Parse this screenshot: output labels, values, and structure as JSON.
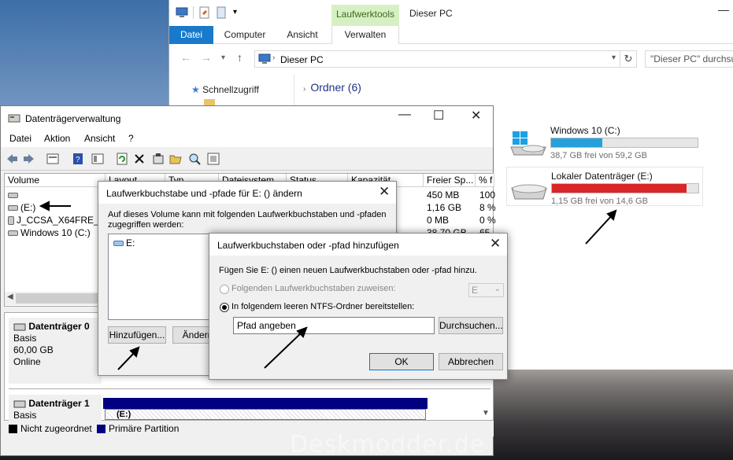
{
  "explorer": {
    "context_tab": "Laufwerktools",
    "title": "Dieser PC",
    "ribbon_tabs": [
      "Datei",
      "Computer",
      "Ansicht",
      "Verwalten"
    ],
    "address": "Dieser PC",
    "search_placeholder": "\"Dieser PC\" durchsuchen",
    "nav_item": "Schnellzugriff",
    "folders_header": "Ordner (6)",
    "drives": [
      {
        "name": "Windows 10 (C:)",
        "free_text": "38,7 GB frei von 59,2 GB",
        "used_fraction": 0.35,
        "bar_color": "#26a0da"
      },
      {
        "name": "Lokaler Datenträger (E:)",
        "free_text": "1,15 GB frei von 14,6 GB",
        "used_fraction": 0.92,
        "bar_color": "#da2626"
      }
    ]
  },
  "diskmgmt": {
    "title": "Datenträgerverwaltung",
    "menu": [
      "Datei",
      "Aktion",
      "Ansicht",
      "?"
    ],
    "columns": [
      "Volume",
      "Layout",
      "Typ",
      "Dateisystem",
      "Status",
      "Kapazität",
      "Freier Sp...",
      "% f"
    ],
    "volumes": [
      "",
      "(E:)",
      "J_CCSA_X64FRE_D...",
      "Windows 10 (C:)"
    ],
    "free_space": [
      "450 MB",
      "1,16 GB",
      "0 MB",
      "38,70 GB"
    ],
    "free_pct": [
      "100",
      "8 %",
      "0 %",
      "65"
    ],
    "disks": [
      {
        "name": "Datenträger 0",
        "type": "Basis",
        "size": "60,00 GB",
        "state": "Online"
      },
      {
        "name": "Datenträger 1",
        "type": "Basis",
        "partition": "(E:)"
      }
    ],
    "legend": {
      "unallocated": "Nicht zugeordnet",
      "primary": "Primäre Partition"
    }
  },
  "dialog_change": {
    "title": "Laufwerkbuchstabe und -pfade für E: () ändern",
    "text": "Auf dieses Volume kann mit folgenden Laufwerkbuchstaben und -pfaden zugegriffen werden:",
    "list_item": "E:",
    "add_button": "Hinzufügen...",
    "change_button": "Ändern..."
  },
  "dialog_add": {
    "title": "Laufwerkbuchstaben oder -pfad hinzufügen",
    "intro": "Fügen Sie E: () einen neuen Laufwerkbuchstaben oder -pfad hinzu.",
    "option_letter": "Folgenden Laufwerkbuchstaben zuweisen:",
    "letter_value": "E",
    "option_folder": "In folgendem leeren NTFS-Ordner bereitstellen:",
    "path_value": "Pfad angeben",
    "browse_button": "Durchsuchen...",
    "ok_button": "OK",
    "cancel_button": "Abbrechen"
  },
  "watermark": "Deskmodder.de"
}
